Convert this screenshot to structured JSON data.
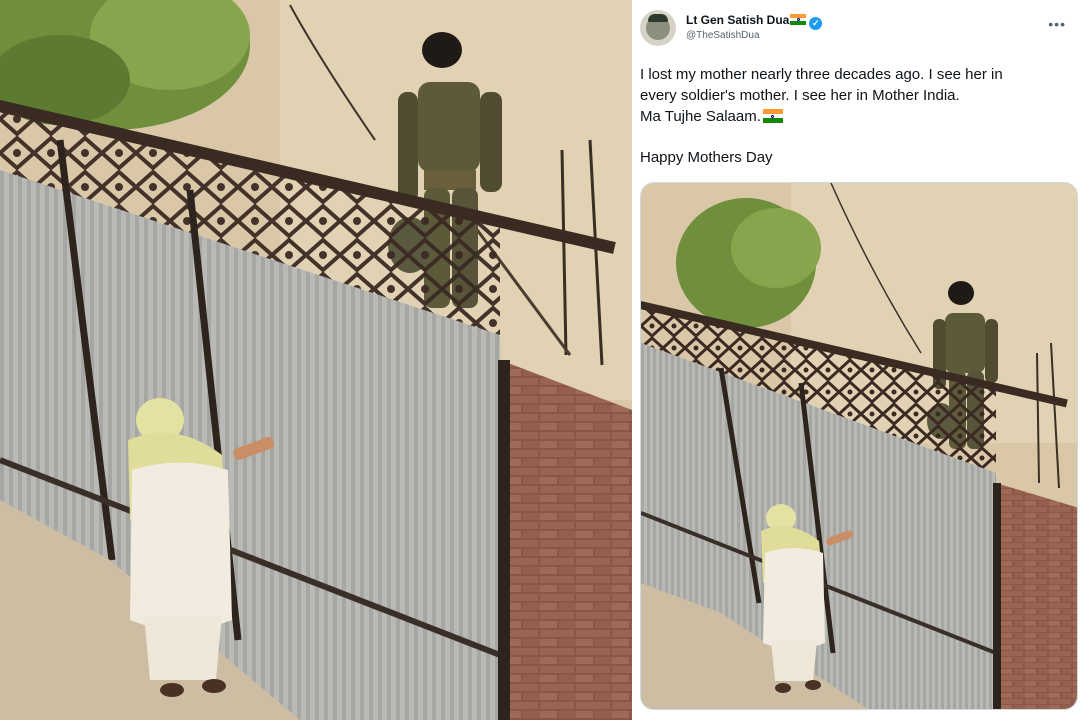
{
  "tweet": {
    "display_name": "Lt Gen Satish Dua",
    "handle": "@TheSatishDua",
    "line1": "I lost my mother nearly three decades ago. I see her in",
    "line2": "every soldier's mother. I see her in Mother India.",
    "line3": "Ma Tujhe Salaam.",
    "line4": "Happy Mothers Day",
    "icons": [
      "avatar",
      "india-flag-icon",
      "verified-badge-icon",
      "more-icon"
    ]
  },
  "colors": {
    "name": "#0f1419",
    "handle": "#536471",
    "verified": "#1d9bf0",
    "flag_saffron": "#ff9933",
    "flag_green": "#138808"
  }
}
